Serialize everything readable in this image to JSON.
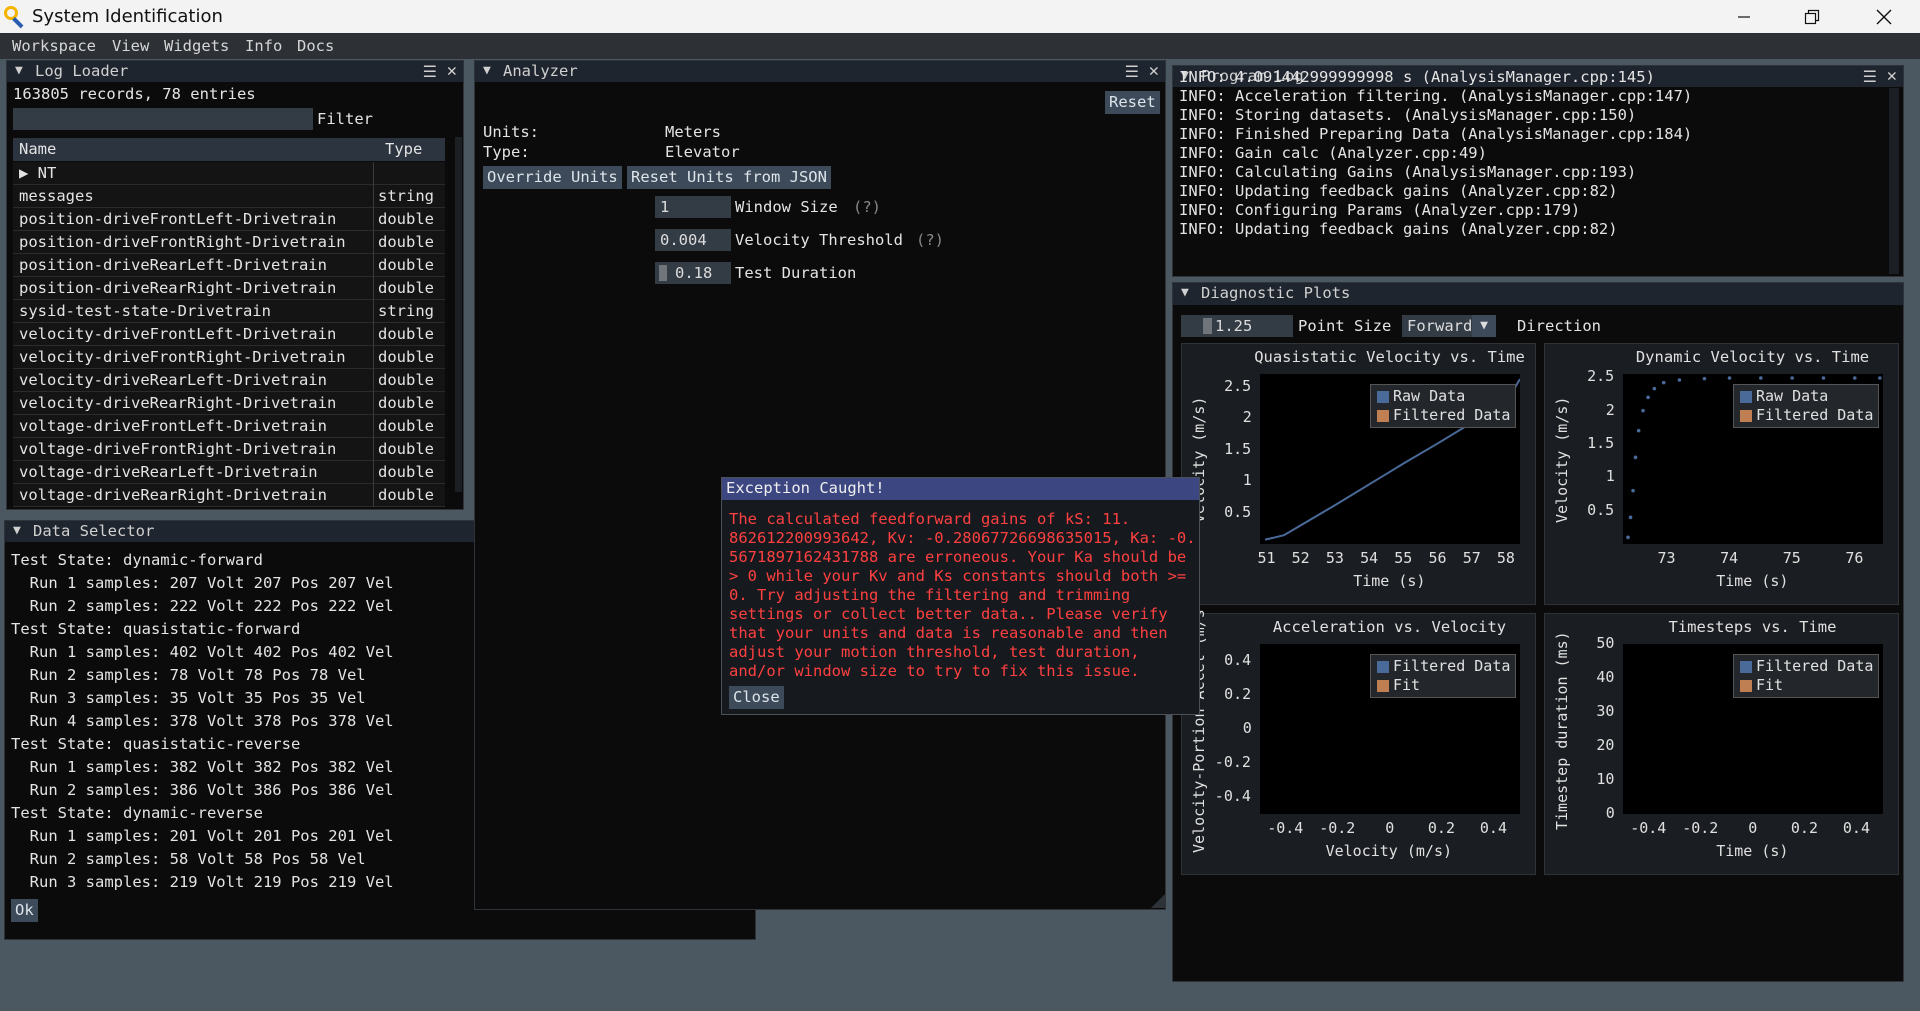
{
  "window": {
    "title": "System Identification"
  },
  "menu": [
    "Workspace",
    "View",
    "Widgets",
    "Info",
    "Docs"
  ],
  "log_loader": {
    "title": "Log Loader",
    "summary": "163805 records, 78 entries",
    "filter_label": "Filter",
    "columns": [
      "Name",
      "Type"
    ],
    "rows": [
      {
        "name": "▶ NT",
        "type": ""
      },
      {
        "name": "messages",
        "type": "string"
      },
      {
        "name": "position-driveFrontLeft-Drivetrain",
        "type": "double"
      },
      {
        "name": "position-driveFrontRight-Drivetrain",
        "type": "double"
      },
      {
        "name": "position-driveRearLeft-Drivetrain",
        "type": "double"
      },
      {
        "name": "position-driveRearRight-Drivetrain",
        "type": "double"
      },
      {
        "name": "sysid-test-state-Drivetrain",
        "type": "string"
      },
      {
        "name": "velocity-driveFrontLeft-Drivetrain",
        "type": "double"
      },
      {
        "name": "velocity-driveFrontRight-Drivetrain",
        "type": "double"
      },
      {
        "name": "velocity-driveRearLeft-Drivetrain",
        "type": "double"
      },
      {
        "name": "velocity-driveRearRight-Drivetrain",
        "type": "double"
      },
      {
        "name": "voltage-driveFrontLeft-Drivetrain",
        "type": "double"
      },
      {
        "name": "voltage-driveFrontRight-Drivetrain",
        "type": "double"
      },
      {
        "name": "voltage-driveRearLeft-Drivetrain",
        "type": "double"
      },
      {
        "name": "voltage-driveRearRight-Drivetrain",
        "type": "double"
      }
    ]
  },
  "data_selector": {
    "title": "Data Selector",
    "ok_label": "Ok",
    "lines": [
      "Test State: dynamic-forward",
      "  Run 1 samples: 207 Volt 207 Pos 207 Vel",
      "  Run 2 samples: 222 Volt 222 Pos 222 Vel",
      "Test State: quasistatic-forward",
      "  Run 1 samples: 402 Volt 402 Pos 402 Vel",
      "  Run 2 samples: 78 Volt 78 Pos 78 Vel",
      "  Run 3 samples: 35 Volt 35 Pos 35 Vel",
      "  Run 4 samples: 378 Volt 378 Pos 378 Vel",
      "Test State: quasistatic-reverse",
      "  Run 1 samples: 382 Volt 382 Pos 382 Vel",
      "  Run 2 samples: 386 Volt 386 Pos 386 Vel",
      "Test State: dynamic-reverse",
      "  Run 1 samples: 201 Volt 201 Pos 201 Vel",
      "  Run 2 samples: 58 Volt 58 Pos 58 Vel",
      "  Run 3 samples: 219 Volt 219 Pos 219 Vel"
    ]
  },
  "analyzer": {
    "title": "Analyzer",
    "reset_label": "Reset",
    "units_label": "Units:",
    "units_value": "Meters",
    "type_label": "Type:",
    "type_value": "Elevator",
    "override_units_label": "Override Units",
    "reset_units_label": "Reset Units from JSON",
    "window_size": {
      "value": "1",
      "label": "Window Size",
      "help": "(?)"
    },
    "velocity_threshold": {
      "value": "0.004",
      "label": "Velocity Threshold",
      "help": "(?)"
    },
    "test_duration": {
      "value": "0.18",
      "label": "Test Duration"
    }
  },
  "program_log": {
    "title": "Program Log",
    "lines": [
      "INFO: 4.091442999999998 s (AnalysisManager.cpp:145)",
      "INFO: Acceleration filtering. (AnalysisManager.cpp:147)",
      "INFO: Storing datasets. (AnalysisManager.cpp:150)",
      "INFO: Finished Preparing Data (AnalysisManager.cpp:184)",
      "INFO: Gain calc (Analyzer.cpp:49)",
      "INFO: Calculating Gains (AnalysisManager.cpp:193)",
      "INFO: Updating feedback gains (Analyzer.cpp:82)",
      "INFO: Configuring Params (Analyzer.cpp:179)",
      "INFO: Updating feedback gains (Analyzer.cpp:82)"
    ]
  },
  "diagnostic": {
    "title": "Diagnostic Plots",
    "point_size_value": "1.25",
    "point_size_label": "Point Size",
    "direction_value": "Forward",
    "direction_label": "Direction"
  },
  "dialog": {
    "title": "Exception Caught!",
    "close_label": "Close",
    "lines": [
      "The calculated feedforward gains of kS: 11.",
      "862612200993642, Kv: -0.28067726698635015, Ka: -0.",
      "5671897162431788 are erroneous. Your Ka should be",
      "> 0 while your Kv and Ks constants should both >=",
      "0. Try adjusting the filtering and trimming",
      "settings or collect better data.. Please verify",
      "that your units and data is reasonable and then",
      "adjust your motion threshold, test duration,",
      "and/or window size to try to fix this issue."
    ]
  },
  "colors": {
    "raw": "#4a6a9a",
    "filtered": "#c07f52",
    "title_accent": "#3c4680",
    "error_text": "#ff4040"
  },
  "chart_data": [
    {
      "type": "line",
      "title": "Quasistatic Velocity vs. Time",
      "xlabel": "Time (s)",
      "ylabel": "Velocity (m/s)",
      "xlim": [
        50.8,
        58.4
      ],
      "ylim": [
        0,
        2.7
      ],
      "xticks": [
        "51",
        "52",
        "53",
        "54",
        "55",
        "56",
        "57",
        "58"
      ],
      "yticks": [
        "0.5",
        "1",
        "1.5",
        "2",
        "2.5"
      ],
      "series": [
        {
          "name": "Raw Data",
          "x": [
            50.95,
            51.2,
            51.5,
            52,
            53,
            54,
            55,
            56,
            57,
            58,
            58.4
          ],
          "y": [
            0.07,
            0.1,
            0.14,
            0.3,
            0.62,
            0.95,
            1.28,
            1.6,
            1.93,
            2.25,
            2.62
          ]
        },
        {
          "name": "Filtered Data",
          "x": [],
          "y": []
        }
      ]
    },
    {
      "type": "scatter",
      "title": "Dynamic Velocity vs. Time",
      "xlabel": "Time (s)",
      "ylabel": "Velocity (m/s)",
      "xlim": [
        72.3,
        76.45
      ],
      "ylim": [
        0,
        2.55
      ],
      "xticks": [
        "73",
        "74",
        "75",
        "76"
      ],
      "yticks": [
        "0.5",
        "1",
        "1.5",
        "2",
        "2.5"
      ],
      "series": [
        {
          "name": "Raw Data",
          "x": [
            72.38,
            72.42,
            72.46,
            72.5,
            72.55,
            72.62,
            72.7,
            72.8,
            72.95,
            73.2,
            73.6,
            74,
            74.5,
            75,
            75.5,
            76,
            76.4
          ],
          "y": [
            0.1,
            0.4,
            0.8,
            1.3,
            1.7,
            2.0,
            2.2,
            2.33,
            2.42,
            2.46,
            2.48,
            2.49,
            2.49,
            2.49,
            2.49,
            2.49,
            2.49
          ]
        },
        {
          "name": "Filtered Data",
          "x": [],
          "y": []
        }
      ]
    },
    {
      "type": "scatter",
      "title": "Acceleration vs. Velocity",
      "xlabel": "Velocity (m/s)",
      "ylabel": "Velocity-Portion Accel (m/s",
      "xlim": [
        -0.5,
        0.5
      ],
      "ylim": [
        -0.5,
        0.5
      ],
      "xticks": [
        "-0.4",
        "-0.2",
        "0",
        "0.2",
        "0.4"
      ],
      "yticks": [
        "0.4",
        "0.2",
        "0",
        "-0.2",
        "-0.4"
      ],
      "series": [
        {
          "name": "Filtered Data",
          "x": [],
          "y": []
        },
        {
          "name": "Fit",
          "x": [],
          "y": []
        }
      ]
    },
    {
      "type": "scatter",
      "title": "Timesteps vs. Time",
      "xlabel": "Time (s)",
      "ylabel": "Timestep duration (ms)",
      "xlim": [
        -0.5,
        0.5
      ],
      "ylim": [
        0,
        50
      ],
      "xticks": [
        "-0.4",
        "-0.2",
        "0",
        "0.2",
        "0.4"
      ],
      "yticks": [
        "50",
        "40",
        "30",
        "20",
        "10",
        "0"
      ],
      "series": [
        {
          "name": "Filtered Data",
          "x": [],
          "y": []
        },
        {
          "name": "Fit",
          "x": [],
          "y": []
        }
      ]
    }
  ]
}
